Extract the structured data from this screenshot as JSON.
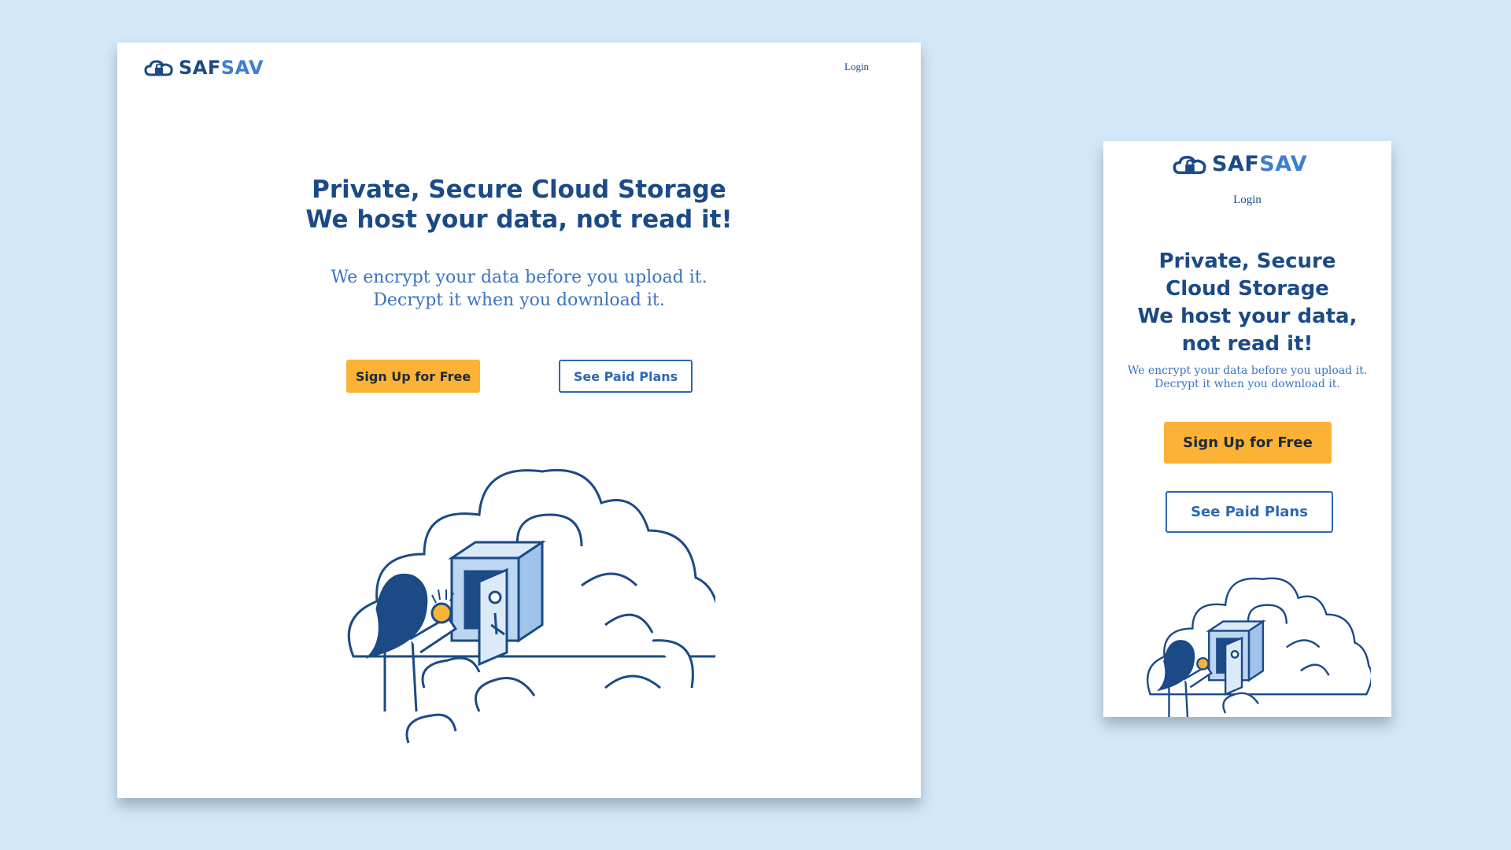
{
  "brand": {
    "name_part1": "SAF",
    "name_part2": "SAV",
    "logo_icon": "cloud-lock-icon",
    "primary_color": "#1b4a86",
    "accent_color": "#3e7ed4",
    "button_color": "#fbb236",
    "background_color": "#d3e8f8"
  },
  "nav": {
    "login_label": "Login"
  },
  "hero": {
    "headline_line1": "Private, Secure Cloud Storage",
    "headline_line2": "We host your data, not read it!",
    "subline_line1": "We encrypt your data before you upload it.",
    "subline_line2": "Decrypt it when you download it."
  },
  "mobile_hero": {
    "headline_line1": "Private, Secure",
    "headline_line2": "Cloud Storage",
    "headline_line3": "We host your data,",
    "headline_line4": "not read it!"
  },
  "actions": {
    "signup_label": "Sign Up for Free",
    "plans_label": "See Paid Plans"
  },
  "illustration": {
    "icon": "cloud-safe-illustration"
  }
}
